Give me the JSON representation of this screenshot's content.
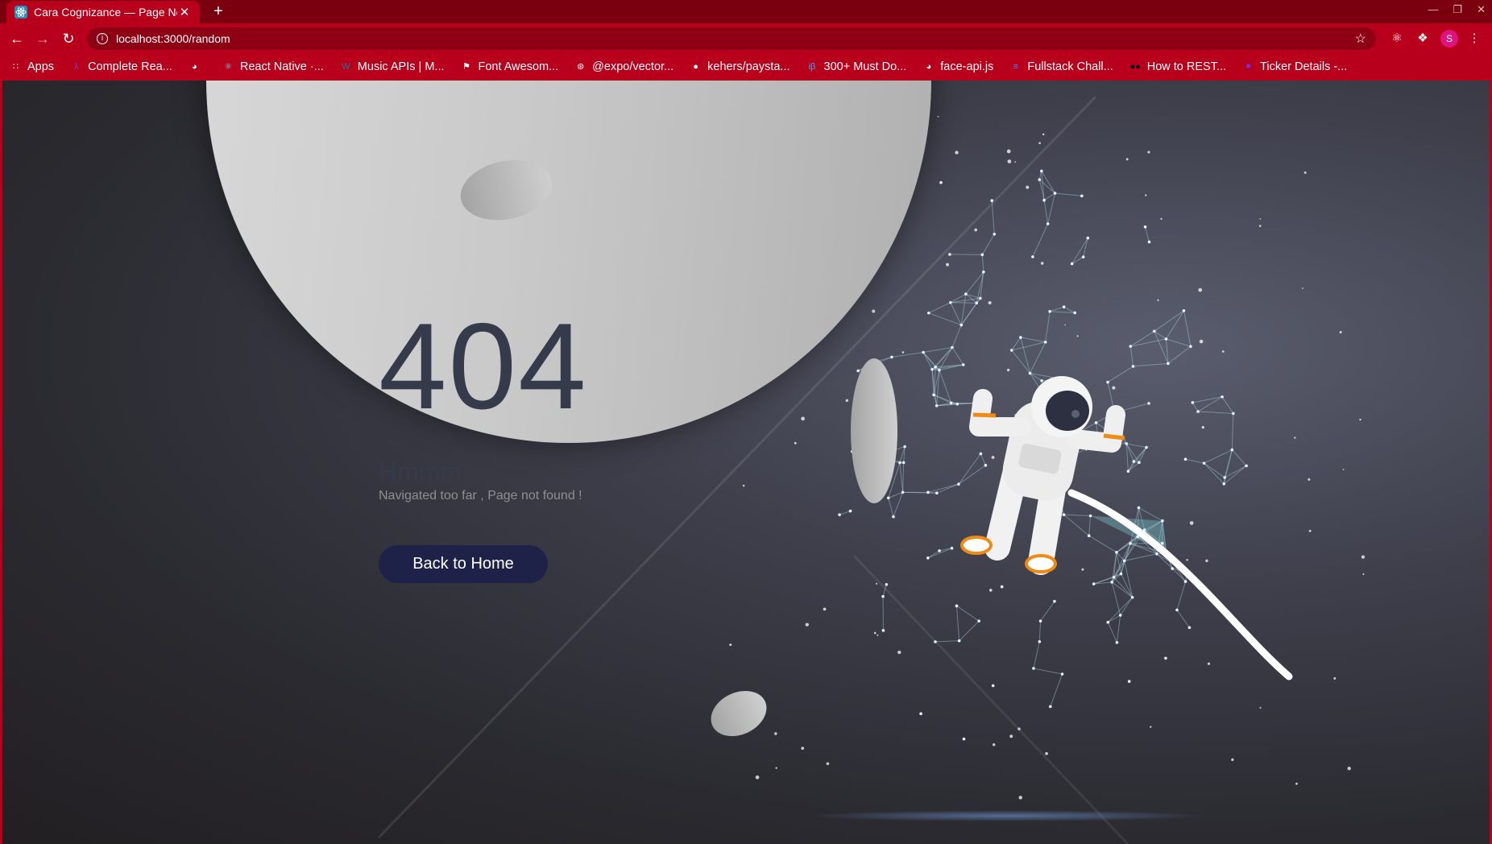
{
  "browser": {
    "tab_title": "Cara Cognizance — Page Not Found",
    "new_tab": "+",
    "close_tab": "✕",
    "url": "localhost:3000/random",
    "avatar_initial": "S",
    "bookmarks": [
      {
        "label": "Apps",
        "icon": "apps-grid-icon",
        "color": "#ffffff"
      },
      {
        "label": "Complete Rea...",
        "icon": "redux-icon",
        "color": "#764abc"
      },
      {
        "label": "",
        "icon": "globe-icon",
        "color": "#ffffff"
      },
      {
        "label": "React Native ·...",
        "icon": "react-icon",
        "color": "#61dafb"
      },
      {
        "label": "Music APIs | M...",
        "icon": "wordpress-icon",
        "color": "#21759b"
      },
      {
        "label": "Font Awesom...",
        "icon": "flag-icon",
        "color": "#ffffff"
      },
      {
        "label": "@expo/vector...",
        "icon": "expo-icon",
        "color": "#ffffff"
      },
      {
        "label": "kehers/paysta...",
        "icon": "github-icon",
        "color": "#ffffff"
      },
      {
        "label": "300+ Must Do...",
        "icon": "ib-icon",
        "color": "#4aa3ff"
      },
      {
        "label": "face-api.js",
        "icon": "globe-icon",
        "color": "#ffffff"
      },
      {
        "label": "Fullstack Chall...",
        "icon": "doc-icon",
        "color": "#4285f4"
      },
      {
        "label": "How to REST...",
        "icon": "medium-icon",
        "color": "#000000"
      },
      {
        "label": "Ticker Details -...",
        "icon": "bulb-icon",
        "color": "#7b2ff7"
      }
    ]
  },
  "error_page": {
    "code": "404",
    "heading": "Hmmm...",
    "message": "Navigated too far , Page not found !",
    "button_label": "Back to Home"
  },
  "colors": {
    "browser_red": "#b8001c",
    "button_navy": "#1e2248",
    "text_dark": "#363b4c",
    "network_cyan": "#7fd6dc"
  }
}
